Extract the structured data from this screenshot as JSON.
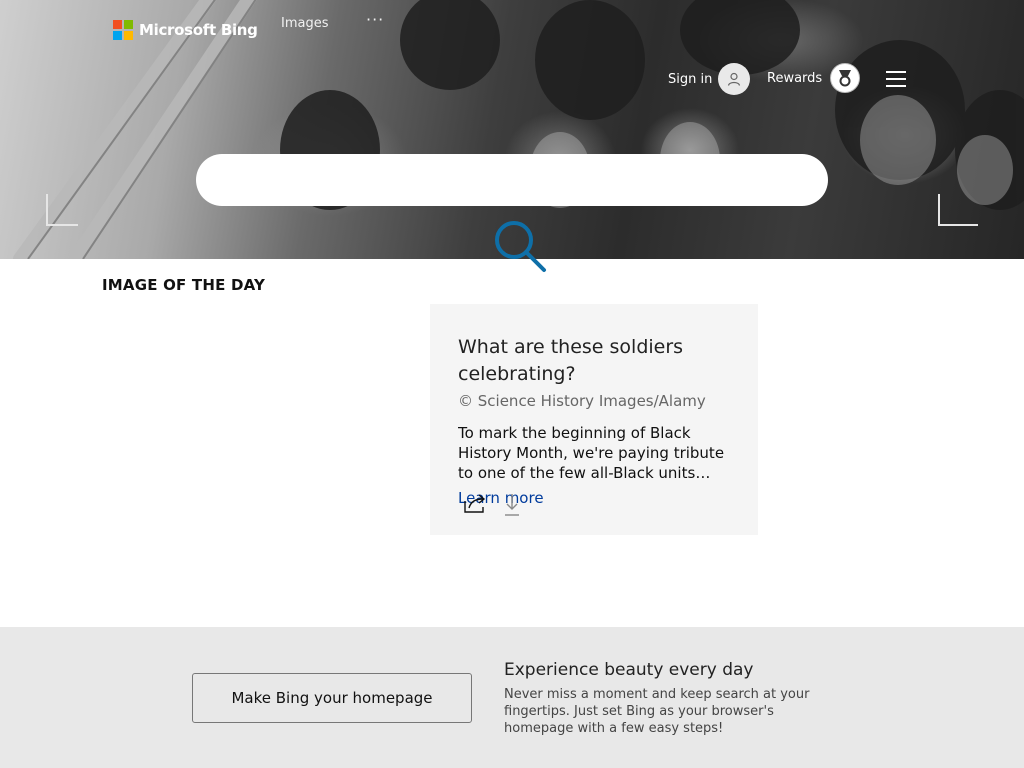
{
  "header": {
    "brand": "Microsoft Bing",
    "nav_images": "Images",
    "nav_more": "···",
    "signin_label": "Sign in",
    "rewards_label": "Rewards",
    "ms_colors": [
      "#f25022",
      "#7fba00",
      "#00a4ef",
      "#ffb900"
    ]
  },
  "search": {
    "placeholder": "",
    "value": "",
    "icon": "search-icon",
    "accent": "#0e6fa8"
  },
  "image_of_day": {
    "heading": "IMAGE OF THE DAY",
    "title": "What are these soldiers celebrating?",
    "credit": "© Science History Images/Alamy",
    "description": "To mark the beginning of Black History Month, we're paying tribute to one of the few all-Black units that fought in World War I.",
    "learn_more": "Learn more",
    "actions": [
      "share-icon",
      "download-icon"
    ]
  },
  "banner": {
    "button_label": "Make Bing your homepage",
    "title": "Experience beauty every day",
    "text": "Never miss a moment and keep search at your fingertips. Just set Bing as your browser's homepage with a few easy steps!"
  }
}
